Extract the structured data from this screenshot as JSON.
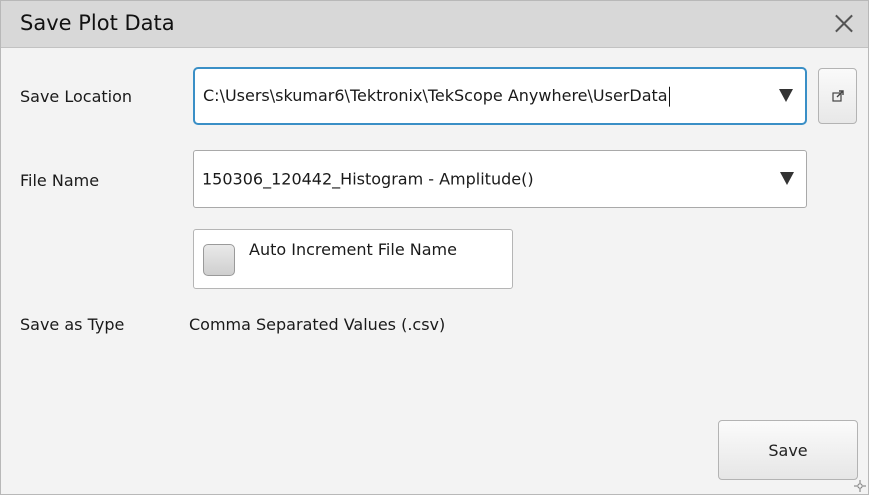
{
  "dialog": {
    "title": "Save Plot Data",
    "close_icon": "close-icon"
  },
  "save_location": {
    "label": "Save Location",
    "value": "C:\\Users\\skumar6\\Tektronix\\TekScope Anywhere\\UserData",
    "dropdown_icon": "dropdown-arrow-icon",
    "browse_icon": "external-link-icon"
  },
  "file_name": {
    "label": "File Name",
    "value": "150306_120442_Histogram - Amplitude()",
    "dropdown_icon": "dropdown-arrow-icon"
  },
  "auto_increment": {
    "label": "Auto Increment File Name",
    "checked": false
  },
  "save_type": {
    "label": "Save as Type",
    "value": "Comma Separated Values (.csv)"
  },
  "buttons": {
    "save_label": "Save"
  },
  "colors": {
    "focus_border": "#3a8fc6",
    "titlebar_bg": "#d8d8d8",
    "dialog_bg": "#f3f3f3"
  }
}
